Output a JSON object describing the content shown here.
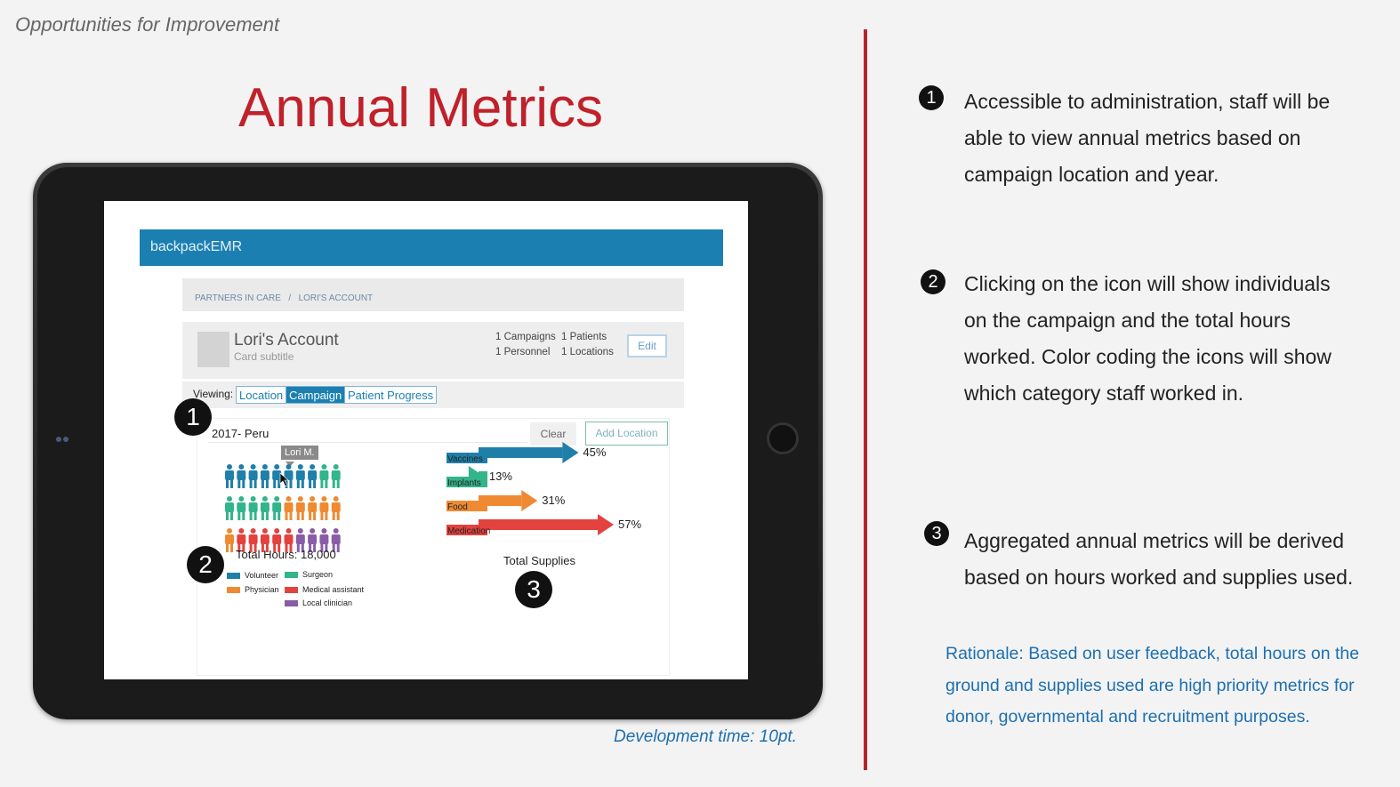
{
  "slide": {
    "kicker": "Opportunities for Improvement",
    "title": "Annual Metrics",
    "dev_time": "Development time: 10pt."
  },
  "colors": {
    "title_red": "#c0212a",
    "divider_red": "#b3282f",
    "app_blue": "#1b80b1",
    "volunteer": "#1f7fa8",
    "surgeon": "#33b48a",
    "physician": "#ef8a33",
    "medical_assistant": "#e3423f",
    "local_clinician": "#8a5ca8"
  },
  "app": {
    "name": "backpackEMR",
    "breadcrumb": [
      "PARTNERS IN CARE",
      "/",
      "LORI'S ACCOUNT"
    ],
    "account": {
      "name": "Lori's Account",
      "subtitle": "Card subtitle",
      "stats": [
        "1 Campaigns",
        "1 Patients",
        "1 Personnel",
        "1 Locations"
      ],
      "edit_label": "Edit"
    },
    "viewing_label": "Viewing:",
    "view_tabs": [
      {
        "label": "Location",
        "active": false
      },
      {
        "label": "Campaign",
        "active": true
      },
      {
        "label": "Patient Progress",
        "active": false
      }
    ],
    "location_value": "2017- Peru",
    "clear_label": "Clear",
    "add_location_label": "Add Location",
    "tooltip_name": "Lori M.",
    "hours_label": "Total Hours: 18,000",
    "people_rows": [
      [
        "volunteer",
        "volunteer",
        "volunteer",
        "volunteer",
        "volunteer",
        "volunteer",
        "volunteer",
        "volunteer",
        "surgeon",
        "surgeon"
      ],
      [
        "surgeon",
        "surgeon",
        "surgeon",
        "surgeon",
        "surgeon",
        "physician",
        "physician",
        "physician",
        "physician",
        "physician"
      ],
      [
        "physician",
        "medical_assistant",
        "medical_assistant",
        "medical_assistant",
        "medical_assistant",
        "medical_assistant",
        "local_clinician",
        "local_clinician",
        "local_clinician",
        "local_clinician"
      ]
    ],
    "legend": [
      {
        "label": "Volunteer",
        "color": "#1f7fa8"
      },
      {
        "label": "Surgeon",
        "color": "#33b48a"
      },
      {
        "label": "Physician",
        "color": "#ef8a33"
      },
      {
        "label": "Medical assistant",
        "color": "#e3423f"
      },
      {
        "label": "Local clinician",
        "color": "#8a5ca8"
      }
    ],
    "supplies_label": "Total Supplies"
  },
  "chart_data": {
    "type": "bar",
    "title": "Total Supplies",
    "categories": [
      "Vaccines",
      "Implants",
      "Food",
      "Medication"
    ],
    "values": [
      45,
      13,
      31,
      57
    ],
    "value_labels": [
      "45%",
      "13%",
      "31%",
      "57%"
    ],
    "colors": [
      "#1f7fa8",
      "#33b48a",
      "#ef8a33",
      "#e3423f"
    ]
  },
  "badges": {
    "one": "1",
    "two": "2",
    "three": "3"
  },
  "notes": [
    {
      "num": "1",
      "lines": [
        "Accessible to administration, staff will be",
        "able to view annual metrics based on",
        "campaign location and year."
      ]
    },
    {
      "num": "2",
      "lines": [
        "Clicking on the icon will show individuals",
        "on the campaign and the total hours",
        "worked. Color coding the icons will show",
        "which category staff worked in."
      ]
    },
    {
      "num": "3",
      "lines": [
        "Aggregated annual metrics will be derived",
        "based on hours worked and supplies used."
      ]
    }
  ],
  "rationale_lines": [
    "Rationale: Based on user feedback, total hours on the",
    "ground and supplies used are high priority metrics for",
    "donor, governmental and recruitment purposes."
  ]
}
